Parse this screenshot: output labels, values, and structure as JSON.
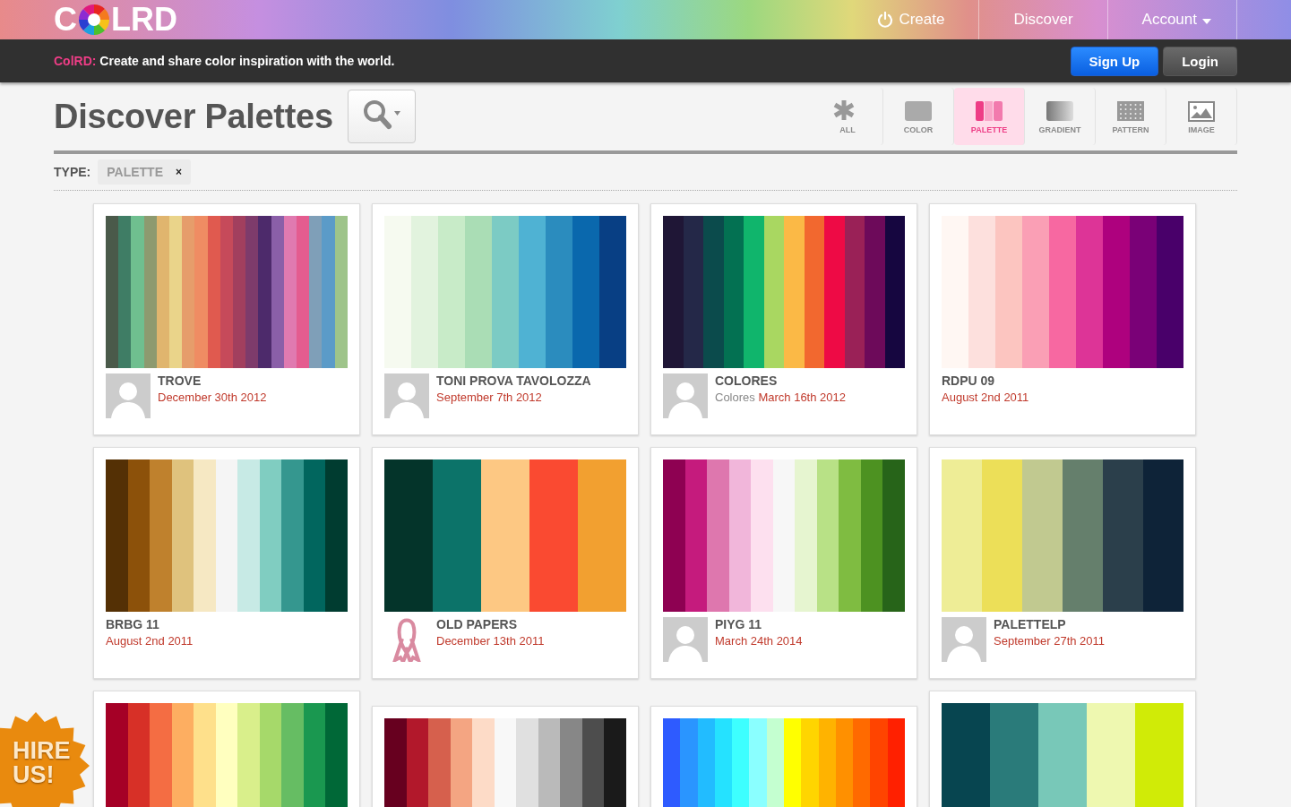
{
  "header": {
    "logo": {
      "before": "C",
      "after": "LRD"
    },
    "nav": [
      {
        "label": "Create",
        "kind": "power"
      },
      {
        "label": "Discover",
        "kind": "plain"
      },
      {
        "label": "Account",
        "kind": "dropdown"
      }
    ],
    "tagline": {
      "brand": "ColRD:",
      "text": "Create and share color inspiration with the world."
    },
    "buttons": [
      {
        "label": "Sign Up",
        "kind": "primary"
      },
      {
        "label": "Login",
        "kind": "secondary"
      }
    ]
  },
  "page": {
    "title": "Discover Palettes",
    "types": [
      {
        "label": "ALL",
        "kind": "all",
        "selected": false
      },
      {
        "label": "COLOR",
        "kind": "color",
        "selected": false
      },
      {
        "label": "PALETTE",
        "kind": "palette",
        "selected": true
      },
      {
        "label": "GRADIENT",
        "kind": "gradient",
        "selected": false
      },
      {
        "label": "PATTERN",
        "kind": "pattern",
        "selected": false
      },
      {
        "label": "IMAGE",
        "kind": "image",
        "selected": false
      }
    ],
    "filter": {
      "label": "TYPE:",
      "value": "PALETTE",
      "remove": "×"
    }
  },
  "columns": [
    [
      {
        "title": "TROVE",
        "date": "December 30th 2012",
        "kind": "person",
        "stripes": [
          {
            "color": "#4a5a4a"
          },
          {
            "color": "#3f7d65"
          },
          {
            "color": "#6fbf8f"
          },
          {
            "color": "#8d9a6f"
          },
          {
            "color": "#e0b56e"
          },
          {
            "color": "#ead48a"
          },
          {
            "color": "#e69d6b"
          },
          {
            "color": "#ef8c63"
          },
          {
            "color": "#e05a4f"
          },
          {
            "color": "#c64a5a"
          },
          {
            "color": "#a23f5e"
          },
          {
            "color": "#7e3b6b"
          },
          {
            "color": "#4d2a6b"
          },
          {
            "color": "#8a5fa8"
          },
          {
            "color": "#e07ab0"
          },
          {
            "color": "#e45c8f"
          },
          {
            "color": "#7f9fb8"
          },
          {
            "color": "#5b9bc8"
          },
          {
            "color": "#9ec48a"
          }
        ]
      },
      {
        "title": "BRBG 11",
        "date": "August 2nd 2011",
        "kind": "plain",
        "stripes": [
          {
            "color": "#543005"
          },
          {
            "color": "#8c510a"
          },
          {
            "color": "#bf812d"
          },
          {
            "color": "#dfc27d"
          },
          {
            "color": "#f6e8c3"
          },
          {
            "color": "#f5f5f5"
          },
          {
            "color": "#c7eae5"
          },
          {
            "color": "#80cdc1"
          },
          {
            "color": "#35978f"
          },
          {
            "color": "#01665e"
          },
          {
            "color": "#003c30"
          }
        ]
      },
      {
        "stripes": [
          {
            "color": "#a50026"
          },
          {
            "color": "#d73027"
          },
          {
            "color": "#f46d43"
          },
          {
            "color": "#fdae61"
          },
          {
            "color": "#fee08b"
          },
          {
            "color": "#ffffbf"
          },
          {
            "color": "#d9ef8b"
          },
          {
            "color": "#a6d96a"
          },
          {
            "color": "#66bd63"
          },
          {
            "color": "#1a9850"
          },
          {
            "color": "#006837"
          }
        ]
      }
    ],
    [
      {
        "title": "TONI PROVA TAVOLOZZA",
        "date": "September 7th 2012",
        "kind": "person",
        "stripes": [
          {
            "color": "#f6faf0"
          },
          {
            "color": "#e2f3de"
          },
          {
            "color": "#c8ebc8"
          },
          {
            "color": "#aaddb5"
          },
          {
            "color": "#7ccbc4"
          },
          {
            "color": "#4fb2d3"
          },
          {
            "color": "#2b8cbe"
          },
          {
            "color": "#0a68ad"
          },
          {
            "color": "#083f84"
          }
        ]
      },
      {
        "title": "OLD PAPERS",
        "date": "December 13th 2011",
        "kind": "ribbon",
        "stripes": [
          {
            "color": "#04342a"
          },
          {
            "color": "#0c7369"
          },
          {
            "color": "#fdc883"
          },
          {
            "color": "#fa4a31"
          },
          {
            "color": "#f2a030"
          }
        ]
      },
      {
        "stripes": [
          {
            "color": "#67001f"
          },
          {
            "color": "#b2182b"
          },
          {
            "color": "#d6604d"
          },
          {
            "color": "#f4a582"
          },
          {
            "color": "#fddbc7"
          },
          {
            "color": "#f8f8f8"
          },
          {
            "color": "#e0e0e0"
          },
          {
            "color": "#bababa"
          },
          {
            "color": "#878787"
          },
          {
            "color": "#4d4d4d"
          },
          {
            "color": "#1a1a1a"
          }
        ]
      }
    ],
    [
      {
        "title": "COLORES",
        "author": "Colores",
        "date": "March 16th 2012",
        "kind": "person",
        "stripes": [
          {
            "color": "#1f1636"
          },
          {
            "color": "#242848"
          },
          {
            "color": "#0b4b4c"
          },
          {
            "color": "#037152"
          },
          {
            "color": "#10b56c"
          },
          {
            "color": "#a9d761"
          },
          {
            "color": "#fbb946"
          },
          {
            "color": "#f2682f"
          },
          {
            "color": "#ee0a45"
          },
          {
            "color": "#9a2157"
          },
          {
            "color": "#6d0a5a"
          },
          {
            "color": "#160640"
          }
        ]
      },
      {
        "title": "PIYG 11",
        "date": "March 24th 2014",
        "kind": "person",
        "stripes": [
          {
            "color": "#8e0152"
          },
          {
            "color": "#c51b7d"
          },
          {
            "color": "#de77ae"
          },
          {
            "color": "#f1b6da"
          },
          {
            "color": "#fde0ef"
          },
          {
            "color": "#f7f7f7"
          },
          {
            "color": "#e6f5d0"
          },
          {
            "color": "#b8e186"
          },
          {
            "color": "#7fbc41"
          },
          {
            "color": "#4d9221"
          },
          {
            "color": "#276419"
          }
        ]
      },
      {
        "stripes": [
          {
            "color": "#2e5bff"
          },
          {
            "color": "#2a95ff"
          },
          {
            "color": "#22bcff"
          },
          {
            "color": "#25e2ff"
          },
          {
            "color": "#3dffff"
          },
          {
            "color": "#8affff"
          },
          {
            "color": "#c4ffd0"
          },
          {
            "color": "#ffff00"
          },
          {
            "color": "#ffd500"
          },
          {
            "color": "#ffb300"
          },
          {
            "color": "#ff9000"
          },
          {
            "color": "#ff6a00"
          },
          {
            "color": "#ff4400"
          },
          {
            "color": "#ff2000"
          }
        ]
      }
    ],
    [
      {
        "title": "RDPU 09",
        "date": "August 2nd 2011",
        "kind": "plain",
        "stripes": [
          {
            "color": "#fff7f3"
          },
          {
            "color": "#fde0dd"
          },
          {
            "color": "#fcc5c0"
          },
          {
            "color": "#fa9fb5"
          },
          {
            "color": "#f768a1"
          },
          {
            "color": "#dd3497"
          },
          {
            "color": "#ae017e"
          },
          {
            "color": "#7a0177"
          },
          {
            "color": "#49006a"
          }
        ]
      },
      {
        "title": "PALETTELP",
        "date": "September 27th 2011",
        "kind": "person",
        "stripes": [
          {
            "color": "#eeed96"
          },
          {
            "color": "#ecdf58"
          },
          {
            "color": "#c1c990"
          },
          {
            "color": "#657f6c"
          },
          {
            "color": "#2b3f4b"
          },
          {
            "color": "#0e2338"
          }
        ]
      },
      {
        "stripes": [
          {
            "color": "#074550"
          },
          {
            "color": "#2a7b7a"
          },
          {
            "color": "#78c8b8"
          },
          {
            "color": "#eef8b0"
          },
          {
            "color": "#d0eb07"
          }
        ]
      }
    ]
  ],
  "badge": {
    "text": "HIRE US!"
  }
}
